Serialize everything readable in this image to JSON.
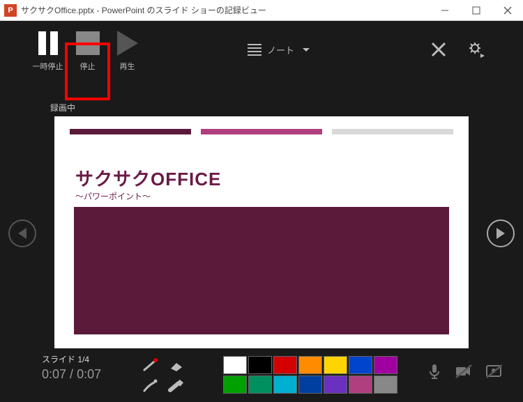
{
  "titlebar": {
    "app_icon_text": "P",
    "title": "サクサクOffice.pptx - PowerPoint のスライド ショーの記録ビュー"
  },
  "toolbar": {
    "pause_label": "一時停止",
    "stop_label": "停止",
    "play_label": "再生",
    "notes_label": "ノート"
  },
  "status": {
    "recording": "録画中"
  },
  "slide": {
    "title": "サクサクOFFICE",
    "subtitle": "～パワーポイント～"
  },
  "footer": {
    "slide_counter": "スライド 1/4",
    "elapsed": "0:07",
    "total": "0:07",
    "separator": " / "
  },
  "palette": {
    "row1": [
      "#ffffff",
      "#000000",
      "#d40000",
      "#ff8c00",
      "#ffd400",
      "#0044cc",
      "#a000a0"
    ],
    "row2": [
      "#00a000",
      "#009060",
      "#00b0d0",
      "#003fa0",
      "#6a30c0",
      "#b03f80",
      "#888888"
    ]
  }
}
